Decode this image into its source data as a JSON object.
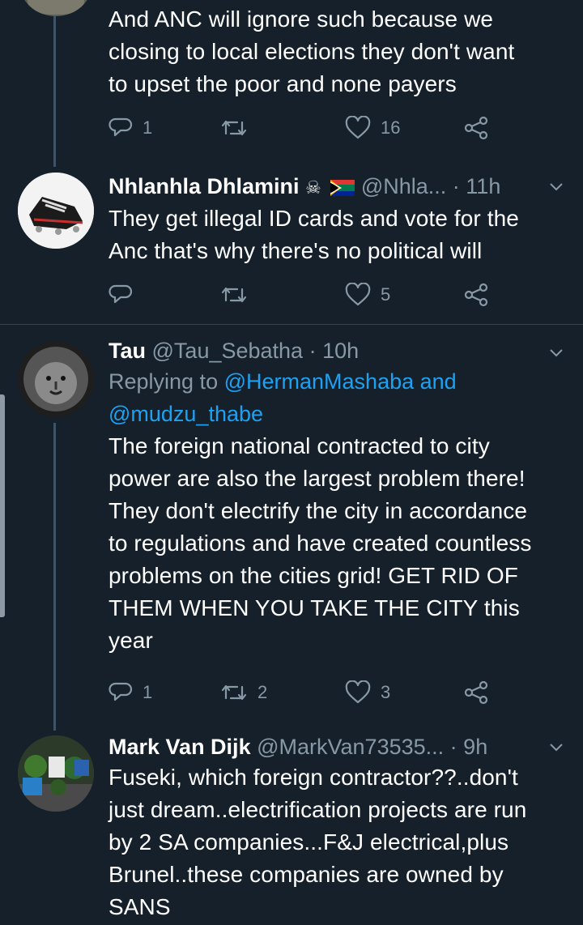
{
  "tweets": [
    {
      "body": "And ANC will ignore such because we\nclosing to local elections they don't want\nto upset the poor and none payers",
      "replies": "1",
      "retweets": "",
      "likes": "16"
    },
    {
      "name": "Nhlanhla Dhlamini",
      "emoji": "☠",
      "handle": "@Nhla...",
      "time": "11h",
      "body": "They get illegal ID cards and vote for the\nAnc that's why there's no political will",
      "replies": "",
      "retweets": "",
      "likes": "5"
    },
    {
      "name": "Tau",
      "handle": "@Tau_Sebatha",
      "time": "10h",
      "replying_prefix": "Replying to",
      "replying_user1": "@HermanMashaba",
      "replying_and": "and",
      "replying_user2": "@mudzu_thabe",
      "body": "The foreign national contracted to city\npower are also the largest problem there!\nThey don't electrify the city in accordance\nto regulations and have created countless\nproblems on the cities grid! GET RID OF\nTHEM WHEN YOU TAKE THE CITY this\nyear",
      "replies": "1",
      "retweets": "2",
      "likes": "3"
    },
    {
      "name": "Mark Van Dijk",
      "handle": "@MarkVan73535...",
      "time": "9h",
      "body": "Fuseki, which foreign contractor??..don't\njust dream..electrification projects are run\nby 2 SA companies...F&J  electrical,plus\nBrunel..these companies are owned by\nSANS"
    }
  ],
  "separator": "·",
  "colors": {
    "background": "#15202b",
    "muted": "#8899a6",
    "link": "#1da1f2",
    "divider": "#38444d"
  },
  "icons": {
    "reply": "reply-icon",
    "retweet": "retweet-icon",
    "like": "heart-icon",
    "share": "share-icon",
    "more": "chevron-down-icon"
  }
}
